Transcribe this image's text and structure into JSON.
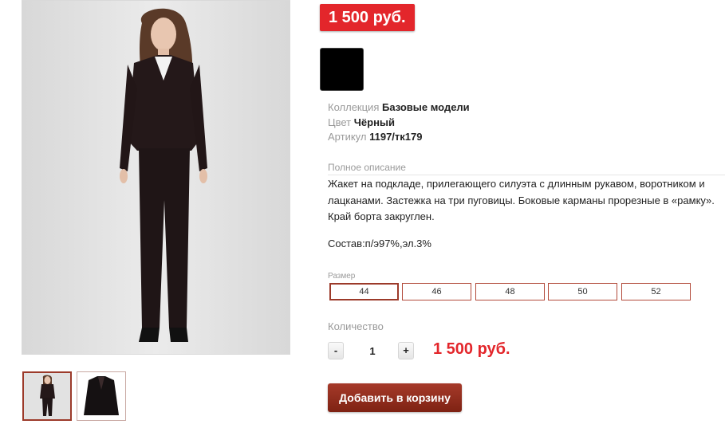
{
  "product": {
    "price_badge": "1 500 руб.",
    "color_swatch": {
      "color": "#000000"
    },
    "attributes": [
      {
        "label": "Коллекция",
        "value": "Базовые модели"
      },
      {
        "label": "Цвет",
        "value": "Чёрный"
      },
      {
        "label": "Артикул",
        "value": "1197/тк179"
      }
    ],
    "description_label": "Полное описание",
    "description": "Жакет на подкладе, прилегающего силуэта с длинным рукавом,  воротником и лацканами. Застежка на три пуговицы. Боковые карманы прорезные в «рамку». Край борта закруглен.",
    "composition": "Состав:п/э97%,эл.3%",
    "size_label": "Размер",
    "sizes": [
      "44",
      "46",
      "48",
      "50",
      "52"
    ],
    "selected_size": "44",
    "quantity_label": "Количество",
    "quantity": "1",
    "qty_minus": "-",
    "qty_plus": "+",
    "total_price": "1 500 руб.",
    "add_to_cart": "Добавить в корзину"
  },
  "gallery": {
    "thumbnails": [
      "model-front-photo",
      "jacket-photo"
    ],
    "active_index": 0
  },
  "colors": {
    "accent_red": "#e3262b",
    "button_brown": "#8e2b1c"
  }
}
